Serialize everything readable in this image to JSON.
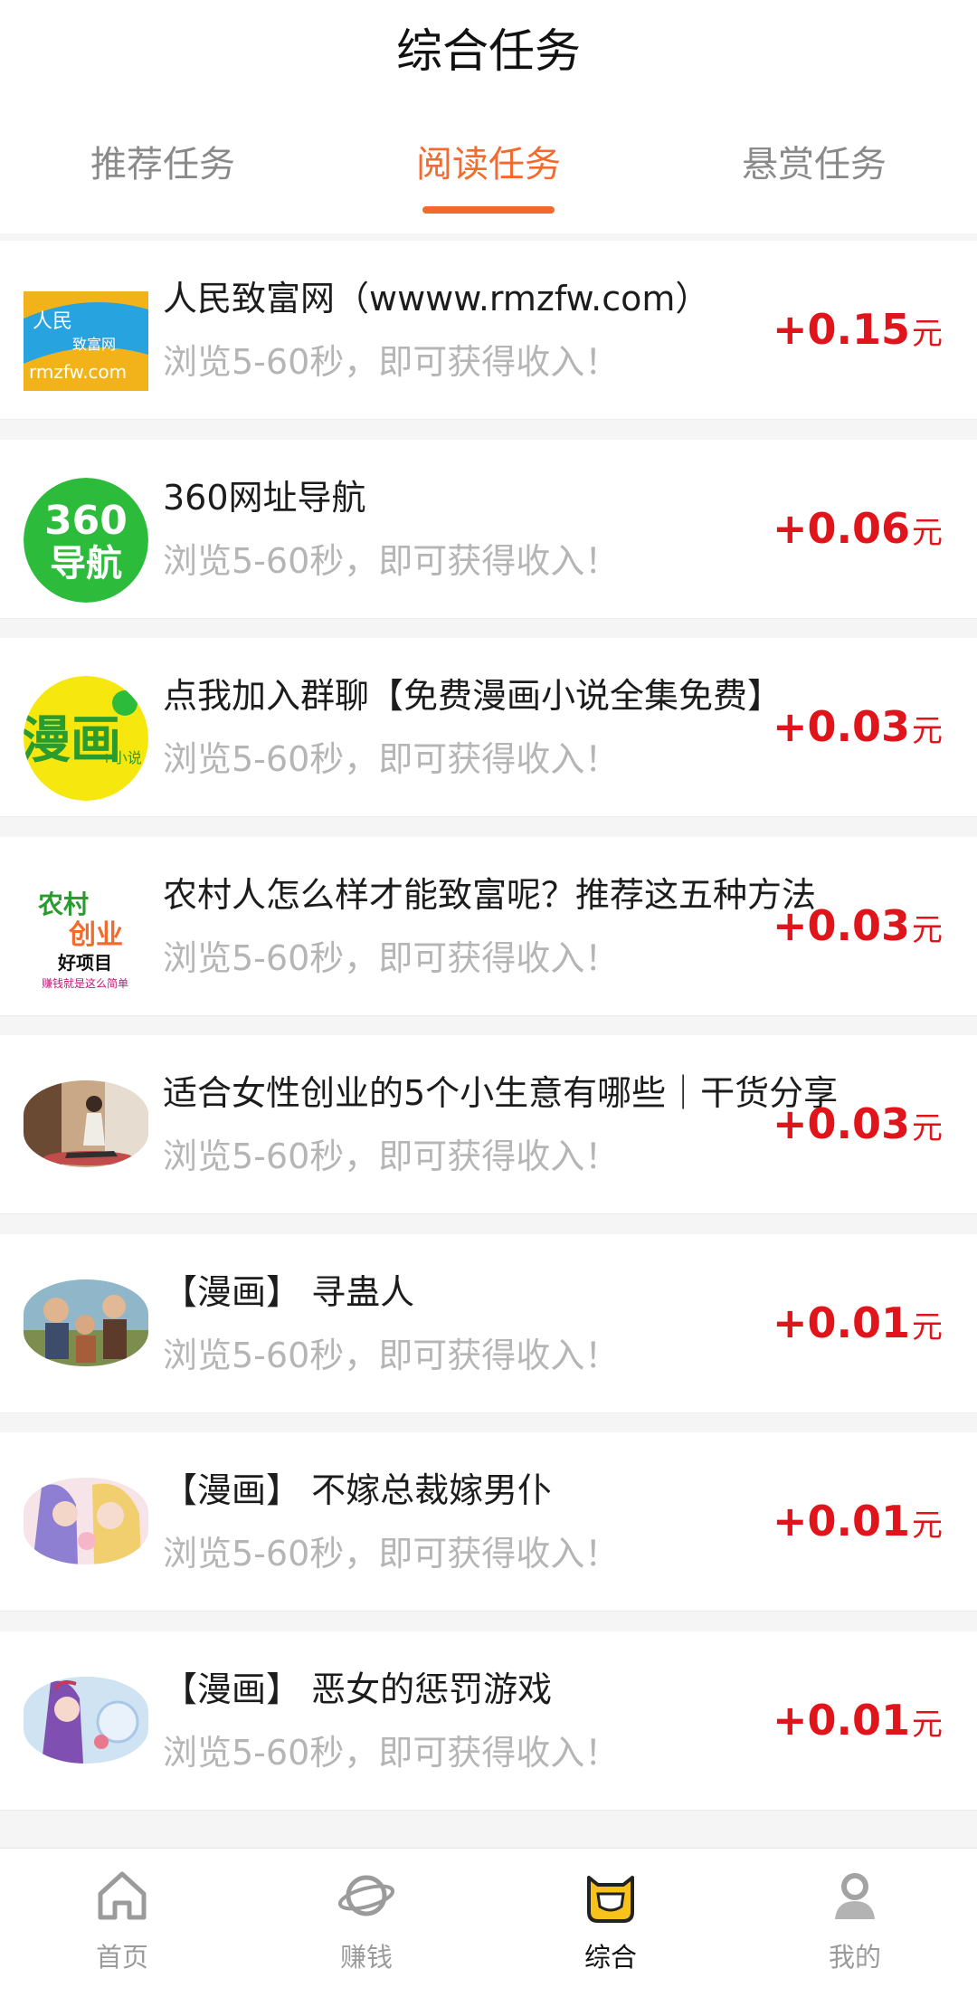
{
  "header": {
    "title": "综合任务"
  },
  "tabs": [
    {
      "label": "推荐任务",
      "active": false
    },
    {
      "label": "阅读任务",
      "active": true
    },
    {
      "label": "悬赏任务",
      "active": false
    }
  ],
  "tasks": [
    {
      "title": "人民致富网（wwww.rmzfw.com）",
      "desc": "浏览5-60秒，即可获得收入！",
      "reward": "+0.15",
      "unit": "元",
      "thumb": "rmzfw-logo",
      "thumb_text": [
        "人民",
        "致富网",
        "rmzfw.com"
      ]
    },
    {
      "title": "360网址导航",
      "desc": "浏览5-60秒，即可获得收入！",
      "reward": "+0.06",
      "unit": "元",
      "thumb": "360-nav-logo",
      "thumb_text": [
        "360",
        "导航"
      ]
    },
    {
      "title": "点我加入群聊【免费漫画小说全集免费】",
      "desc": "浏览5-60秒，即可获得收入！",
      "reward": "+0.03",
      "unit": "元",
      "thumb": "manhua-logo",
      "thumb_text": [
        "漫画",
        "+小说"
      ]
    },
    {
      "title": "农村人怎么样才能致富呢？推荐这五种方法",
      "desc": "浏览5-60秒，即可获得收入！",
      "reward": "+0.03",
      "unit": "元",
      "thumb": "rural-business-logo",
      "thumb_text": [
        "农村",
        "创业",
        "好项目",
        "赚钱就是这么简单"
      ]
    },
    {
      "title": "适合女性创业的5个小生意有哪些｜干货分享",
      "desc": "浏览5-60秒，即可获得收入！",
      "reward": "+0.03",
      "unit": "元",
      "thumb": "yoga-photo"
    },
    {
      "title": "【漫画】 寻蛊人",
      "desc": "浏览5-60秒，即可获得收入！",
      "reward": "+0.01",
      "unit": "元",
      "thumb": "comic-cover"
    },
    {
      "title": "【漫画】 不嫁总裁嫁男仆",
      "desc": "浏览5-60秒，即可获得收入！",
      "reward": "+0.01",
      "unit": "元",
      "thumb": "comic-cover"
    },
    {
      "title": "【漫画】 恶女的惩罚游戏",
      "desc": "浏览5-60秒，即可获得收入！",
      "reward": "+0.01",
      "unit": "元",
      "thumb": "comic-cover"
    }
  ],
  "bottom_nav": [
    {
      "label": "首页",
      "icon": "home-icon",
      "active": false
    },
    {
      "label": "赚钱",
      "icon": "planet-icon",
      "active": false
    },
    {
      "label": "综合",
      "icon": "mascot-icon",
      "active": true
    },
    {
      "label": "我的",
      "icon": "profile-icon",
      "active": false
    }
  ],
  "colors": {
    "accent": "#f26a2e",
    "reward": "#e0151b",
    "muted": "#b5b5b5"
  }
}
